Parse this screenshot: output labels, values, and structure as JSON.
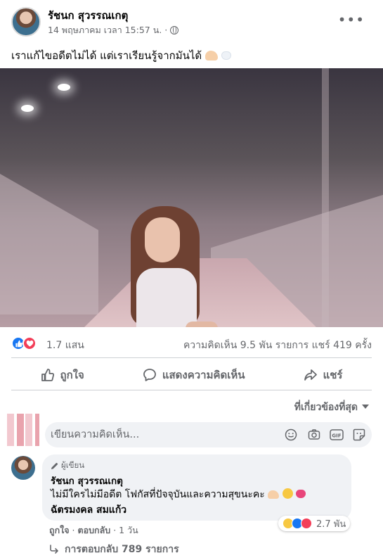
{
  "post": {
    "author": "รัชนก สุวรรณเกตุ",
    "timestamp": "14 พฤษภาคม เวลา 15:57 น. ·",
    "caption": "เราแก้ไขอดีตไม่ได้ แต่เราเรียนรู้จากมันได้",
    "more_icon": "more-horizontal-icon",
    "privacy_icon": "globe-icon"
  },
  "stats": {
    "reactions_count": "1.7 แสน",
    "comments_shares": "ความคิดเห็น 9.5 พัน รายการ  แชร์ 419 ครั้ง"
  },
  "actions": {
    "like": "ถูกใจ",
    "comment": "แสดงความคิดเห็น",
    "share": "แชร์"
  },
  "sort": {
    "label": "ที่เกี่ยวข้องที่สุด"
  },
  "composer": {
    "placeholder": "เขียนความคิดเห็น..."
  },
  "comment": {
    "badge": "ผู้เขียน",
    "author": "รัชนก สุวรรณเกตุ",
    "text": "ไม่มีใครไม่มีอดีต โฟกัสที่ปัจจุบันและความสุขนะคะ",
    "tag": "ฉัตรมงคล สมแก้ว",
    "reactions_count": "2.7 พัน",
    "like": "ถูกใจ",
    "sep1": " · ",
    "reply": "ตอบกลับ",
    "sep2": " · ",
    "time": "1 วัน"
  },
  "replies": {
    "label": "การตอบกลับ 789 รายการ"
  },
  "colors": {
    "like_blue": "#1877f2",
    "love_red": "#f33e58",
    "text_secondary": "#65676b",
    "bubble_bg": "#f0f2f5"
  }
}
